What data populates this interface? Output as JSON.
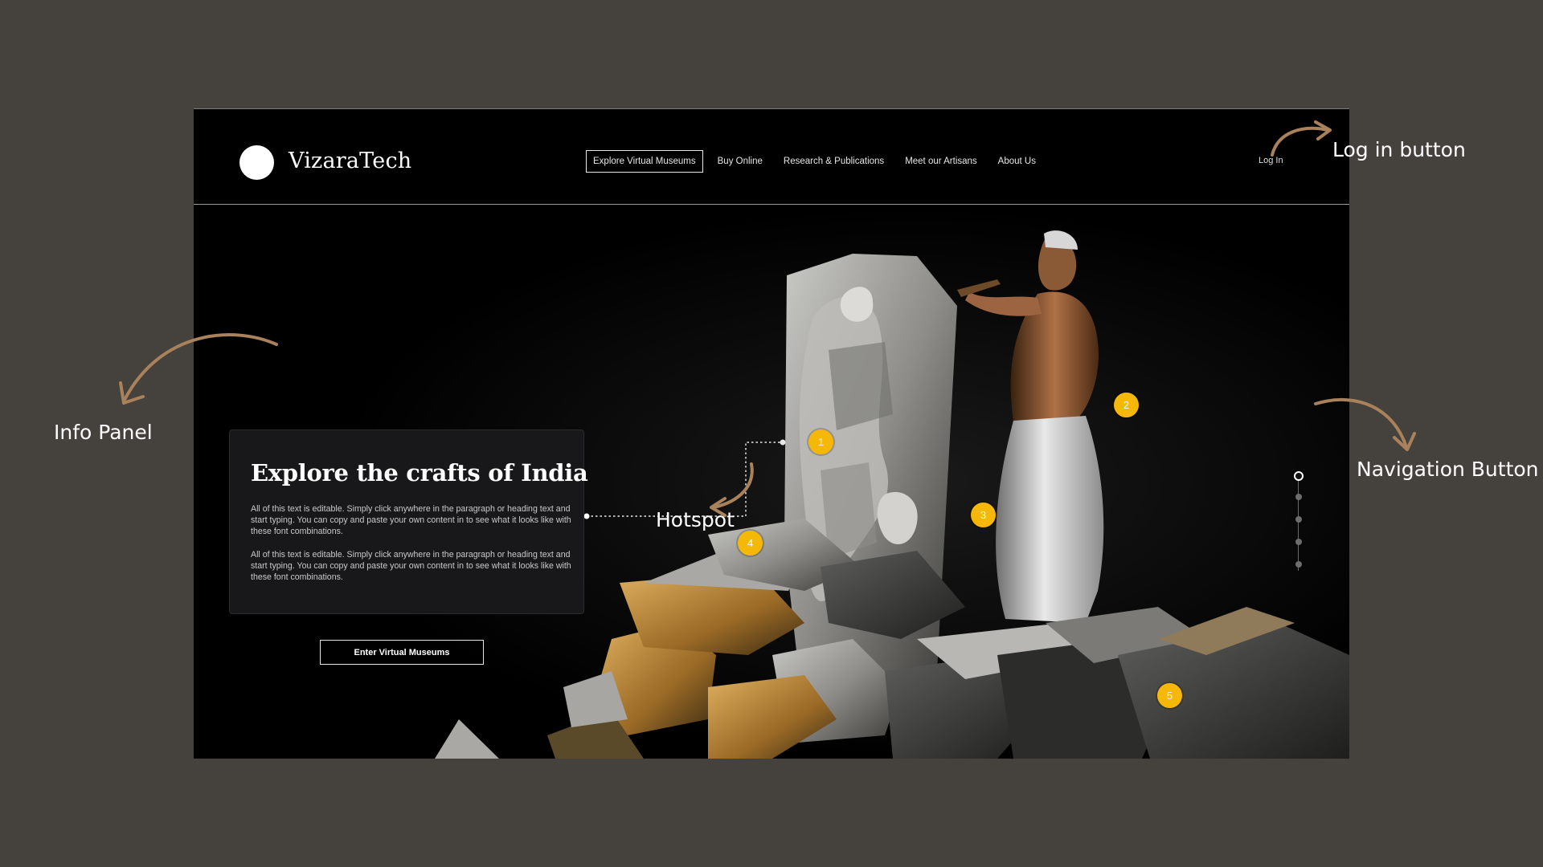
{
  "brand": {
    "name": "VizaraTech"
  },
  "nav": {
    "items": [
      {
        "label": "Explore Virtual Museums",
        "active": true
      },
      {
        "label": "Buy Online",
        "active": false
      },
      {
        "label": "Research & Publications",
        "active": false
      },
      {
        "label": "Meet our Artisans",
        "active": false
      },
      {
        "label": "About Us",
        "active": false
      }
    ],
    "login_label": "Log In"
  },
  "info_panel": {
    "title": "Explore the crafts of India",
    "paragraphs": [
      "All of this text is editable. Simply click anywhere in the paragraph or heading text and start typing. You can copy and paste your own content in to see what it looks like with these font combinations.",
      "All of this text is editable. Simply click anywhere in the paragraph or heading text and start typing. You can copy and paste your own content in to see what it looks like with these font combinations."
    ],
    "cta_label": "Enter Virtual Museums"
  },
  "hotspots": [
    "1",
    "2",
    "3",
    "4",
    "5"
  ],
  "side_navigation": {
    "dot_count": 5,
    "active_index": 0
  },
  "annotations": {
    "login": "Log in button",
    "info_panel": "Info Panel",
    "hotspot": "Hotspot",
    "navigation": "Navigation Button"
  },
  "colors": {
    "canvas_background": "#45413d",
    "hero_background": "#000000",
    "hotspot": "#f6b808",
    "arrow": "#a9815a",
    "text": "#ffffff"
  },
  "icons": {
    "logo": "logo-circle-icon",
    "annotation_arrows": "curved-arrow-icon"
  }
}
